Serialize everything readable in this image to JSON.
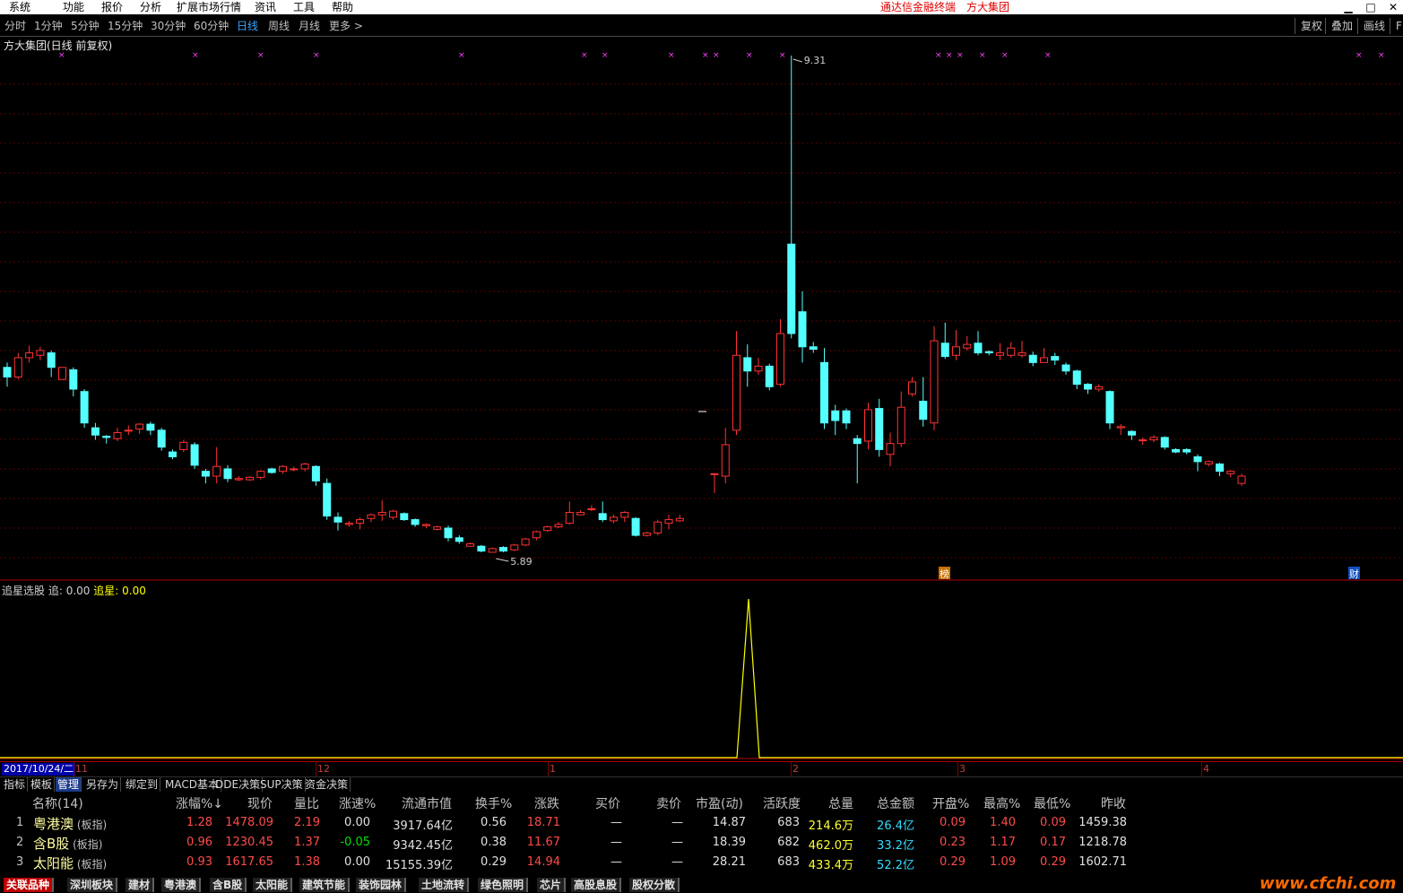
{
  "menu": {
    "items": [
      "系统",
      "功能",
      "报价",
      "分析",
      "扩展市场行情",
      "资讯",
      "工具",
      "帮助"
    ],
    "brand": "通达信金融终端",
    "stock_title": "方大集团"
  },
  "periods": {
    "items": [
      "分时",
      "1分钟",
      "5分钟",
      "15分钟",
      "30分钟",
      "60分钟",
      "日线",
      "周线",
      "月线",
      "更多 >"
    ],
    "active": "日线",
    "tools": [
      "复权",
      "叠加",
      "画线",
      "F"
    ]
  },
  "chart": {
    "title": "方大集团(日线 前复权)",
    "high_label": "9.31",
    "low_label": "5.89",
    "marker_bang": "榜",
    "marker_cai": "财",
    "candles": [
      [
        5.88,
        5.96,
        5.8,
        6.0,
        0
      ],
      [
        5.88,
        6.04,
        5.86,
        6.08,
        1
      ],
      [
        6.04,
        6.08,
        6.0,
        6.14,
        1
      ],
      [
        6.06,
        6.1,
        6.02,
        6.13,
        1
      ],
      [
        6.08,
        5.96,
        5.88,
        6.1,
        0
      ],
      [
        5.86,
        5.96,
        5.86,
        5.96,
        1
      ],
      [
        5.94,
        5.78,
        5.72,
        5.96,
        0
      ],
      [
        5.76,
        5.5,
        5.46,
        5.78,
        0
      ],
      [
        5.46,
        5.4,
        5.36,
        5.5,
        0
      ],
      [
        5.39,
        5.38,
        5.33,
        5.4,
        0
      ],
      [
        5.37,
        5.42,
        5.35,
        5.46,
        1
      ],
      [
        5.44,
        5.44,
        5.4,
        5.48,
        1
      ],
      [
        5.45,
        5.49,
        5.41,
        5.5,
        1
      ],
      [
        5.49,
        5.44,
        5.4,
        5.51,
        0
      ],
      [
        5.44,
        5.3,
        5.27,
        5.46,
        0
      ],
      [
        5.26,
        5.22,
        5.2,
        5.28,
        0
      ],
      [
        5.28,
        5.34,
        5.26,
        5.36,
        1
      ],
      [
        5.32,
        5.15,
        5.12,
        5.34,
        0
      ],
      [
        5.1,
        5.06,
        5.0,
        5.12,
        0
      ],
      [
        5.06,
        5.14,
        5.0,
        5.3,
        1
      ],
      [
        5.12,
        5.04,
        5.01,
        5.15,
        0
      ],
      [
        5.03,
        5.04,
        5.02,
        5.06,
        1
      ],
      [
        5.03,
        5.05,
        5.02,
        5.06,
        1
      ],
      [
        5.05,
        5.1,
        5.03,
        5.11,
        1
      ],
      [
        5.12,
        5.09,
        5.08,
        5.13,
        0
      ],
      [
        5.1,
        5.14,
        5.08,
        5.15,
        1
      ],
      [
        5.12,
        5.12,
        5.1,
        5.14,
        1
      ],
      [
        5.12,
        5.16,
        5.1,
        5.17,
        1
      ],
      [
        5.14,
        5.02,
        4.98,
        5.15,
        0
      ],
      [
        5.0,
        4.73,
        4.7,
        5.04,
        0
      ],
      [
        4.72,
        4.68,
        4.61,
        4.76,
        0
      ],
      [
        4.66,
        4.67,
        4.64,
        4.69,
        1
      ],
      [
        4.67,
        4.7,
        4.62,
        4.72,
        1
      ],
      [
        4.71,
        4.74,
        4.68,
        4.75,
        1
      ],
      [
        4.74,
        4.76,
        4.69,
        4.86,
        1
      ],
      [
        4.77,
        4.72,
        4.7,
        4.78,
        1
      ],
      [
        4.75,
        4.7,
        4.69,
        4.76,
        0
      ],
      [
        4.7,
        4.66,
        4.64,
        4.71,
        0
      ],
      [
        4.66,
        4.65,
        4.63,
        4.67,
        1
      ],
      [
        4.64,
        4.62,
        4.61,
        4.65,
        1
      ],
      [
        4.63,
        4.55,
        4.52,
        4.65,
        0
      ],
      [
        4.55,
        4.52,
        4.5,
        4.57,
        0
      ],
      [
        4.5,
        4.48,
        4.48,
        4.51,
        1
      ],
      [
        4.48,
        4.44,
        4.43,
        4.49,
        0
      ],
      [
        4.43,
        4.46,
        4.43,
        4.47,
        1
      ],
      [
        4.47,
        4.44,
        4.43,
        4.48,
        0
      ],
      [
        4.45,
        4.49,
        4.44,
        4.5,
        1
      ],
      [
        4.49,
        4.54,
        4.48,
        4.55,
        1
      ],
      [
        4.55,
        4.6,
        4.53,
        4.61,
        1
      ],
      [
        4.61,
        4.64,
        4.6,
        4.65,
        1
      ],
      [
        4.64,
        4.66,
        4.63,
        4.68,
        1
      ],
      [
        4.67,
        4.76,
        4.66,
        4.85,
        1
      ],
      [
        4.74,
        4.76,
        4.74,
        4.78,
        1
      ],
      [
        4.79,
        4.79,
        4.77,
        4.82,
        1
      ],
      [
        4.75,
        4.7,
        4.68,
        4.85,
        0
      ],
      [
        4.69,
        4.72,
        4.67,
        4.74,
        1
      ],
      [
        4.72,
        4.76,
        4.68,
        4.77,
        1
      ],
      [
        4.71,
        4.57,
        4.56,
        4.72,
        0
      ],
      [
        4.57,
        4.59,
        4.56,
        4.6,
        1
      ],
      [
        4.59,
        4.68,
        4.57,
        4.7,
        1
      ],
      [
        4.67,
        4.7,
        4.62,
        4.74,
        1
      ],
      [
        4.69,
        4.71,
        4.68,
        4.74,
        1
      ],
      [
        5.08,
        5.08,
        4.92,
        5.08,
        1
      ],
      [
        5.06,
        5.32,
        5.0,
        5.46,
        1
      ],
      [
        5.44,
        6.06,
        5.4,
        6.26,
        1
      ],
      [
        6.04,
        5.93,
        5.8,
        6.15,
        0
      ],
      [
        5.93,
        5.97,
        5.9,
        6.04,
        1
      ],
      [
        5.97,
        5.8,
        5.77,
        5.99,
        0
      ],
      [
        5.82,
        6.24,
        5.8,
        6.36,
        1
      ],
      [
        6.24,
        6.98,
        6.2,
        8.54,
        0
      ],
      [
        6.42,
        6.13,
        6.0,
        6.59,
        0
      ],
      [
        6.13,
        6.11,
        6.08,
        6.17,
        0
      ],
      [
        6.0,
        5.5,
        5.45,
        6.12,
        0
      ],
      [
        5.6,
        5.52,
        5.4,
        5.65,
        0
      ],
      [
        5.5,
        5.6,
        5.45,
        5.62,
        0
      ],
      [
        5.37,
        5.33,
        5.0,
        5.4,
        0
      ],
      [
        5.35,
        5.61,
        5.28,
        5.67,
        1
      ],
      [
        5.62,
        5.28,
        5.22,
        5.7,
        0
      ],
      [
        5.24,
        5.33,
        5.14,
        5.42,
        1
      ],
      [
        5.33,
        5.63,
        5.3,
        5.76,
        1
      ],
      [
        5.74,
        5.84,
        5.72,
        5.88,
        1
      ],
      [
        5.68,
        5.53,
        5.47,
        5.88,
        0
      ],
      [
        5.5,
        6.18,
        5.44,
        6.3,
        1
      ],
      [
        6.16,
        6.05,
        6.03,
        6.33,
        0
      ],
      [
        6.06,
        6.13,
        6.02,
        6.27,
        1
      ],
      [
        6.12,
        6.15,
        6.1,
        6.22,
        1
      ],
      [
        6.16,
        6.08,
        6.06,
        6.26,
        0
      ],
      [
        6.08,
        6.09,
        6.06,
        6.1,
        0
      ],
      [
        6.08,
        6.06,
        6.02,
        6.16,
        1
      ],
      [
        6.06,
        6.12,
        6.04,
        6.17,
        1
      ],
      [
        6.08,
        6.06,
        6.04,
        6.18,
        1
      ],
      [
        6.06,
        6.0,
        5.97,
        6.09,
        0
      ],
      [
        6.0,
        6.04,
        6.0,
        6.12,
        1
      ],
      [
        6.05,
        6.02,
        5.98,
        6.08,
        0
      ],
      [
        5.98,
        5.93,
        5.9,
        6.0,
        0
      ],
      [
        5.93,
        5.82,
        5.78,
        5.94,
        0
      ],
      [
        5.82,
        5.78,
        5.74,
        5.83,
        0
      ],
      [
        5.78,
        5.8,
        5.76,
        5.82,
        1
      ],
      [
        5.76,
        5.5,
        5.45,
        5.77,
        0
      ],
      [
        5.47,
        5.46,
        5.4,
        5.49,
        1
      ],
      [
        5.43,
        5.4,
        5.36,
        5.44,
        0
      ],
      [
        5.36,
        5.36,
        5.32,
        5.38,
        1
      ],
      [
        5.36,
        5.38,
        5.34,
        5.4,
        1
      ],
      [
        5.38,
        5.3,
        5.28,
        5.39,
        0
      ],
      [
        5.28,
        5.26,
        5.25,
        5.29,
        0
      ],
      [
        5.26,
        5.28,
        5.24,
        5.29,
        0
      ],
      [
        5.22,
        5.18,
        5.1,
        5.24,
        0
      ],
      [
        5.18,
        5.16,
        5.14,
        5.19,
        1
      ],
      [
        5.16,
        5.1,
        5.06,
        5.17,
        0
      ],
      [
        5.1,
        5.08,
        5.05,
        5.11,
        1
      ],
      [
        5.06,
        5.0,
        4.98,
        5.08,
        1
      ]
    ]
  },
  "indicator": {
    "title": "追星选股",
    "label1": "追: 0.00",
    "label2": "追星",
    "value2": ": 0.00"
  },
  "time_axis": {
    "date": "2017/10/24/二",
    "ticks": [
      "11",
      "12",
      "1",
      "2",
      "3",
      "4"
    ]
  },
  "tool_tabs": [
    "指标",
    "模板",
    "管理",
    "另存为",
    "绑定到",
    "MACD基本",
    "DDE决策",
    "SUP决策",
    "资金决策"
  ],
  "tool_tab_selected": "管理",
  "table": {
    "headers": [
      "名称(14)",
      "涨幅%↓",
      "现价",
      "量比",
      "涨速%",
      "流通市值",
      "换手%",
      "涨跌",
      "买价",
      "卖价",
      "市盈(动)",
      "活跃度",
      "总量",
      "总金额",
      "开盘%",
      "最高%",
      "最低%",
      "昨收"
    ],
    "rows": [
      {
        "n": "1",
        "name": "粤港澳",
        "sub": "(板指)",
        "cells": [
          "1.28",
          "1478.09",
          "2.19",
          "0.00",
          "3917.64亿",
          "0.56",
          "18.71",
          "—",
          "—",
          "14.87",
          "683",
          "214.6万",
          "26.4亿",
          "0.09",
          "1.40",
          "0.09",
          "1459.38"
        ]
      },
      {
        "n": "2",
        "name": "含B股",
        "sub": "(板指)",
        "cells": [
          "0.96",
          "1230.45",
          "1.37",
          "-0.05",
          "9342.45亿",
          "0.38",
          "11.67",
          "—",
          "—",
          "18.39",
          "682",
          "462.0万",
          "33.2亿",
          "0.23",
          "1.17",
          "0.17",
          "1218.78"
        ]
      },
      {
        "n": "3",
        "name": "太阳能",
        "sub": "(板指)",
        "cells": [
          "0.93",
          "1617.65",
          "1.38",
          "0.00",
          "15155.39亿",
          "0.29",
          "14.94",
          "—",
          "—",
          "28.21",
          "683",
          "433.4万",
          "52.2亿",
          "0.29",
          "1.09",
          "0.29",
          "1602.71"
        ]
      }
    ]
  },
  "bottom_tabs": [
    "关联品种",
    "深圳板块",
    "建材",
    "粤港澳",
    "含B股",
    "太阳能",
    "建筑节能",
    "装饰园林",
    "土地流转",
    "绿色照明",
    "芯片",
    "高股息股",
    "股权分散"
  ],
  "watermark": "www.cfchi.com"
}
